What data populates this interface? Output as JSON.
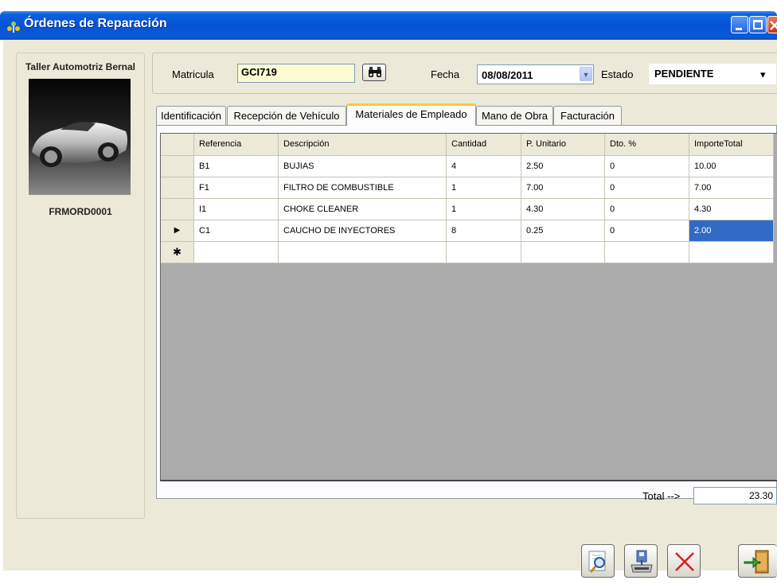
{
  "window": {
    "title": "Órdenes de Reparación"
  },
  "left_panel": {
    "workshop_name": "Taller Automotriz Bernal",
    "order_code": "FRMORD0001"
  },
  "header": {
    "matricula_label": "Matricula",
    "matricula_value": "GCI719",
    "fecha_label": "Fecha",
    "fecha_value": "08/08/2011",
    "estado_label": "Estado",
    "estado_value": "PENDIENTE"
  },
  "tabs": [
    {
      "label": "Identificación",
      "active": false
    },
    {
      "label": "Recepción de Vehículo",
      "active": false
    },
    {
      "label": "Materiales de Empleado",
      "active": true
    },
    {
      "label": "Mano de Obra",
      "active": false
    },
    {
      "label": "Facturación",
      "active": false
    }
  ],
  "grid": {
    "columns": [
      "Referencia",
      "Descripción",
      "Cantidad",
      "P. Unitario",
      "Dto. %",
      "ImporteTotal"
    ],
    "rows": [
      [
        "B1",
        "BUJIAS",
        "4",
        "2.50",
        "0",
        "10.00"
      ],
      [
        "F1",
        "FILTRO DE COMBUSTIBLE",
        "1",
        "7.00",
        "0",
        "7.00"
      ],
      [
        "I1",
        "CHOKE CLEANER",
        "1",
        "4.30",
        "0",
        "4.30"
      ],
      [
        "C1",
        "CAUCHO DE INYECTORES",
        "8",
        "0.25",
        "0",
        "2.00"
      ]
    ],
    "current_row_marker": "▶",
    "new_row_marker": "✱"
  },
  "footer": {
    "total_label": "Total -->",
    "total_value": "23.30"
  },
  "colors": {
    "titlebar": "#0553d6",
    "selection": "#316ac5",
    "matricula_bg": "#fdfbd2",
    "active_tab_accent": "#ffc83c"
  },
  "icons": [
    "app-icon",
    "binoculars-icon",
    "magnifier-icon",
    "save-disk-icon",
    "cancel-x-icon",
    "exit-door-icon"
  ]
}
